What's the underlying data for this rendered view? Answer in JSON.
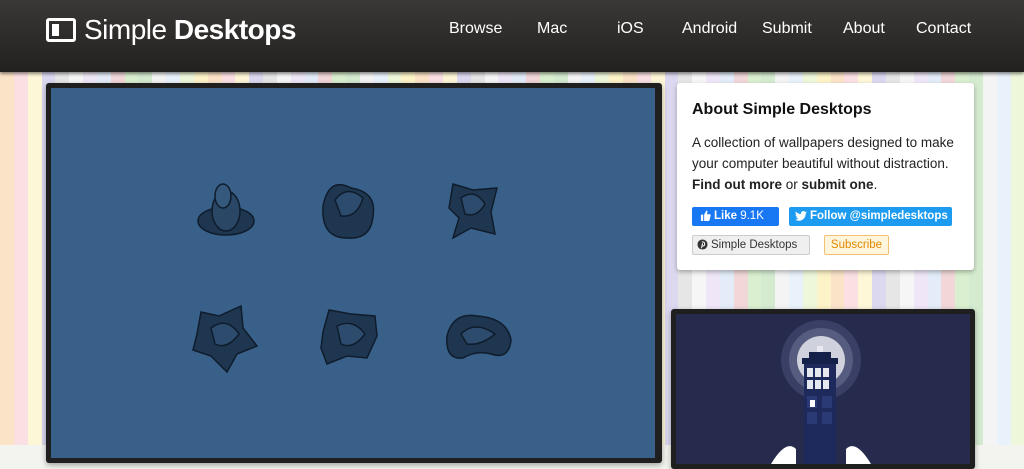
{
  "site": {
    "logo_word1": "Simple",
    "logo_word2": "Desktops",
    "logo_icon": "desktop-monitor-icon"
  },
  "nav": {
    "items": [
      {
        "label": "Browse"
      },
      {
        "label": "Mac"
      },
      {
        "label": "iOS"
      },
      {
        "label": "Android"
      },
      {
        "label": "Submit"
      },
      {
        "label": "About"
      },
      {
        "label": "Contact"
      }
    ]
  },
  "about": {
    "title": "About Simple Desktops",
    "text_part1": "A collection of wallpapers designed to make your computer beautiful without distraction.",
    "find_out_more": "Find out more",
    "or": "or",
    "submit_one": "submit one",
    "period": "."
  },
  "social": {
    "like_label": "Like",
    "like_count": "9.1K",
    "follow_label": "Follow @simpledesktops",
    "pinterest_label": "Simple Desktops",
    "subscribe_label": "Subscribe"
  },
  "featured": {
    "background_color": "#386089",
    "shape_color": "#1f3650"
  },
  "secondary": {
    "background_color": "#262a4d"
  },
  "colors": {
    "header": "#2b2928",
    "facebook": "#1877f2",
    "twitter": "#1d9bf0",
    "subscribe_text": "#e08a00"
  }
}
